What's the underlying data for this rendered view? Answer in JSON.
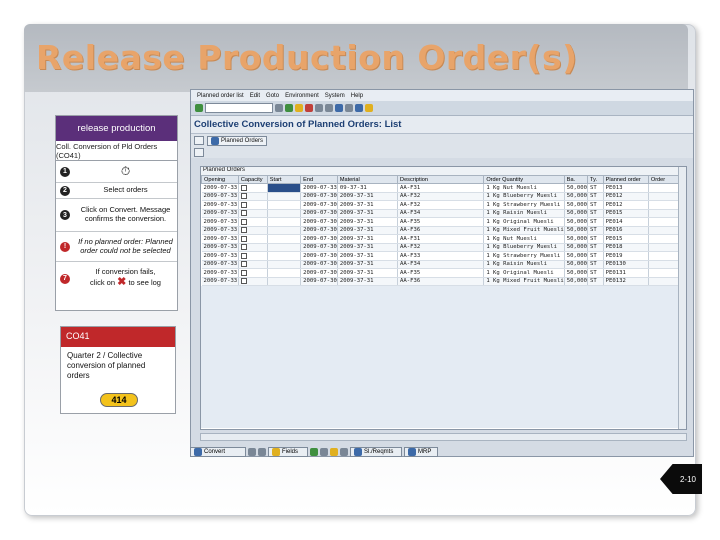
{
  "slide": {
    "title": "Release Production Order(s)",
    "page": "2-10"
  },
  "steps_panel": {
    "header": "release production",
    "subheader": "Coll. Conversion of Pld Orders (CO41)",
    "steps": [
      {
        "num": "1",
        "text": "",
        "icon": "clock-icon",
        "italic": false,
        "red": false
      },
      {
        "num": "2",
        "text": "Select orders",
        "italic": false,
        "red": false
      },
      {
        "num": "3",
        "text": "Click on Convert. Message confirms the conversion.",
        "italic": false,
        "red": false
      },
      {
        "num": "!",
        "text": "If no planned order: Planned order could not be selected",
        "italic": true,
        "red": true
      },
      {
        "num": "7",
        "text": "If conversion fails,",
        "text2": "click on",
        "text3": "to see log",
        "italic": false,
        "red": true
      }
    ]
  },
  "co41_card": {
    "code": "CO41",
    "description": "Quarter 2 / Collective conversion of planned orders",
    "number": "414"
  },
  "sap": {
    "menu": [
      "Planned order list",
      "Edit",
      "Goto",
      "Environment",
      "System",
      "Help"
    ],
    "title": "Collective Conversion of Planned Orders: List",
    "planned_orders_button": "Planned Orders",
    "grid_label": "Planned Orders",
    "columns": [
      "Opening",
      "Capacity",
      "Start",
      "End",
      "Material",
      "Description",
      "Order Quantity",
      "Ba.",
      "Ty.",
      "Planned order",
      "Order"
    ],
    "rows": [
      [
        "2009-07-33",
        "",
        "2009-07-33",
        "09-37-31",
        "AA-F31",
        "1 Kg Nut Muesli",
        "50,000",
        "ST",
        "PE013",
        ""
      ],
      [
        "2009-07-33",
        "",
        "2009-07-30",
        "2009-37-31",
        "AA-F32",
        "1 Kg Blueberry Muesli",
        "50,000",
        "ST",
        "PE012",
        ""
      ],
      [
        "2009-07-33",
        "",
        "2009-07-30",
        "2009-37-31",
        "AA-F32",
        "1 Kg Strawberry Muesli",
        "50,000",
        "ST",
        "PE012",
        ""
      ],
      [
        "2009-07-33",
        "",
        "2009-07-30",
        "2009-37-31",
        "AA-F34",
        "1 Kg Raisin Muesli",
        "50,000",
        "ST",
        "PE015",
        ""
      ],
      [
        "2009-07-33",
        "",
        "2009-07-30",
        "2009-37-31",
        "AA-F35",
        "1 Kg Original Muesli",
        "50,000",
        "ST",
        "PE014",
        ""
      ],
      [
        "2009-07-33",
        "",
        "2009-07-30",
        "2009-37-31",
        "AA-F36",
        "1 Kg Mixed Fruit Muesli",
        "50,000",
        "ST",
        "PE016",
        ""
      ],
      [
        "2009-07-33",
        "",
        "2009-07-30",
        "2009-37-31",
        "AA-F31",
        "1 Kg Nut Muesli",
        "50,000",
        "ST",
        "PE015",
        ""
      ],
      [
        "2009-07-33",
        "",
        "2009-07-30",
        "2009-37-31",
        "AA-F32",
        "1 Kg Blueberry Muesli",
        "50,000",
        "ST",
        "PE018",
        ""
      ],
      [
        "2009-07-33",
        "",
        "2009-07-30",
        "2009-37-31",
        "AA-F33",
        "1 Kg Strawberry Muesli",
        "50,000",
        "ST",
        "PE019",
        ""
      ],
      [
        "2009-07-33",
        "",
        "2009-07-30",
        "2009-37-31",
        "AA-F34",
        "1 Kg Raisin Muesli",
        "50,000",
        "ST",
        "PE0130",
        ""
      ],
      [
        "2009-07-33",
        "",
        "2009-07-30",
        "2009-37-31",
        "AA-F35",
        "1 Kg Original Muesli",
        "50,000",
        "ST",
        "PE0131",
        ""
      ],
      [
        "2009-07-33",
        "",
        "2009-07-30",
        "2009-37-31",
        "AA-F36",
        "1 Kg Mixed Fruit Muesli",
        "50,000",
        "ST",
        "PE0132",
        ""
      ]
    ],
    "bottom_buttons": [
      "Convert",
      "Fields",
      "Sl./Reqmts",
      "MRP"
    ]
  }
}
